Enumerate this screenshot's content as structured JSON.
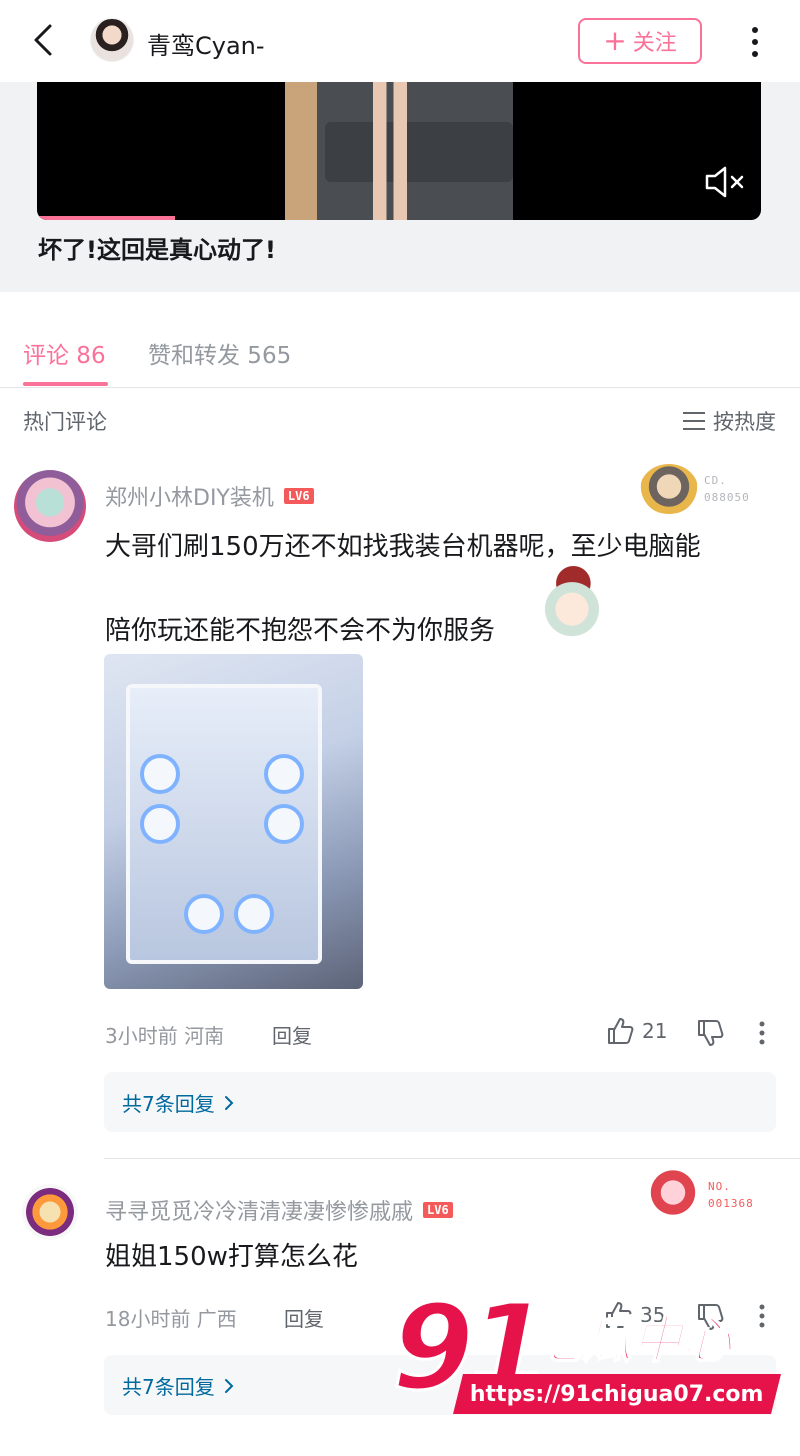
{
  "header": {
    "username": "青鸾Cyan-",
    "follow_label": "关注"
  },
  "video": {
    "title": "坏了!这回是真心动了!",
    "progress": 0.19
  },
  "tabs": {
    "comments_label": "评论 86",
    "likes_label": "赞和转发 565"
  },
  "section": {
    "title": "热门评论",
    "sort_label": "按热度"
  },
  "comments": [
    {
      "username": "郑州小林DIY装机",
      "level": "LV6",
      "fan_badge": [
        "CD.",
        "088050"
      ],
      "text_line1": "大哥们刷150万还不如找我装台机器呢，至少电脑能",
      "text_line2": "陪你玩还能不抱怨不会不为你服务",
      "meta": "3小时前 河南",
      "reply_label": "回复",
      "likes": "21",
      "replies_label": "共7条回复"
    },
    {
      "username": "寻寻觅觅冷冷清清凄凄惨惨戚戚",
      "level": "LV6",
      "fan_badge": [
        "NO.",
        "001368"
      ],
      "text_line1": "姐姐150w打算怎么花",
      "meta": "18小时前 广西",
      "reply_label": "回复",
      "likes": "35",
      "replies_label": "共7条回复"
    }
  ],
  "watermark": {
    "number": "91",
    "brand": "吃瓜中心",
    "url": "https://91chigua07.com"
  },
  "colors": {
    "accent": "#fb7299",
    "link": "#00699d",
    "watermark": "#e6124a"
  }
}
